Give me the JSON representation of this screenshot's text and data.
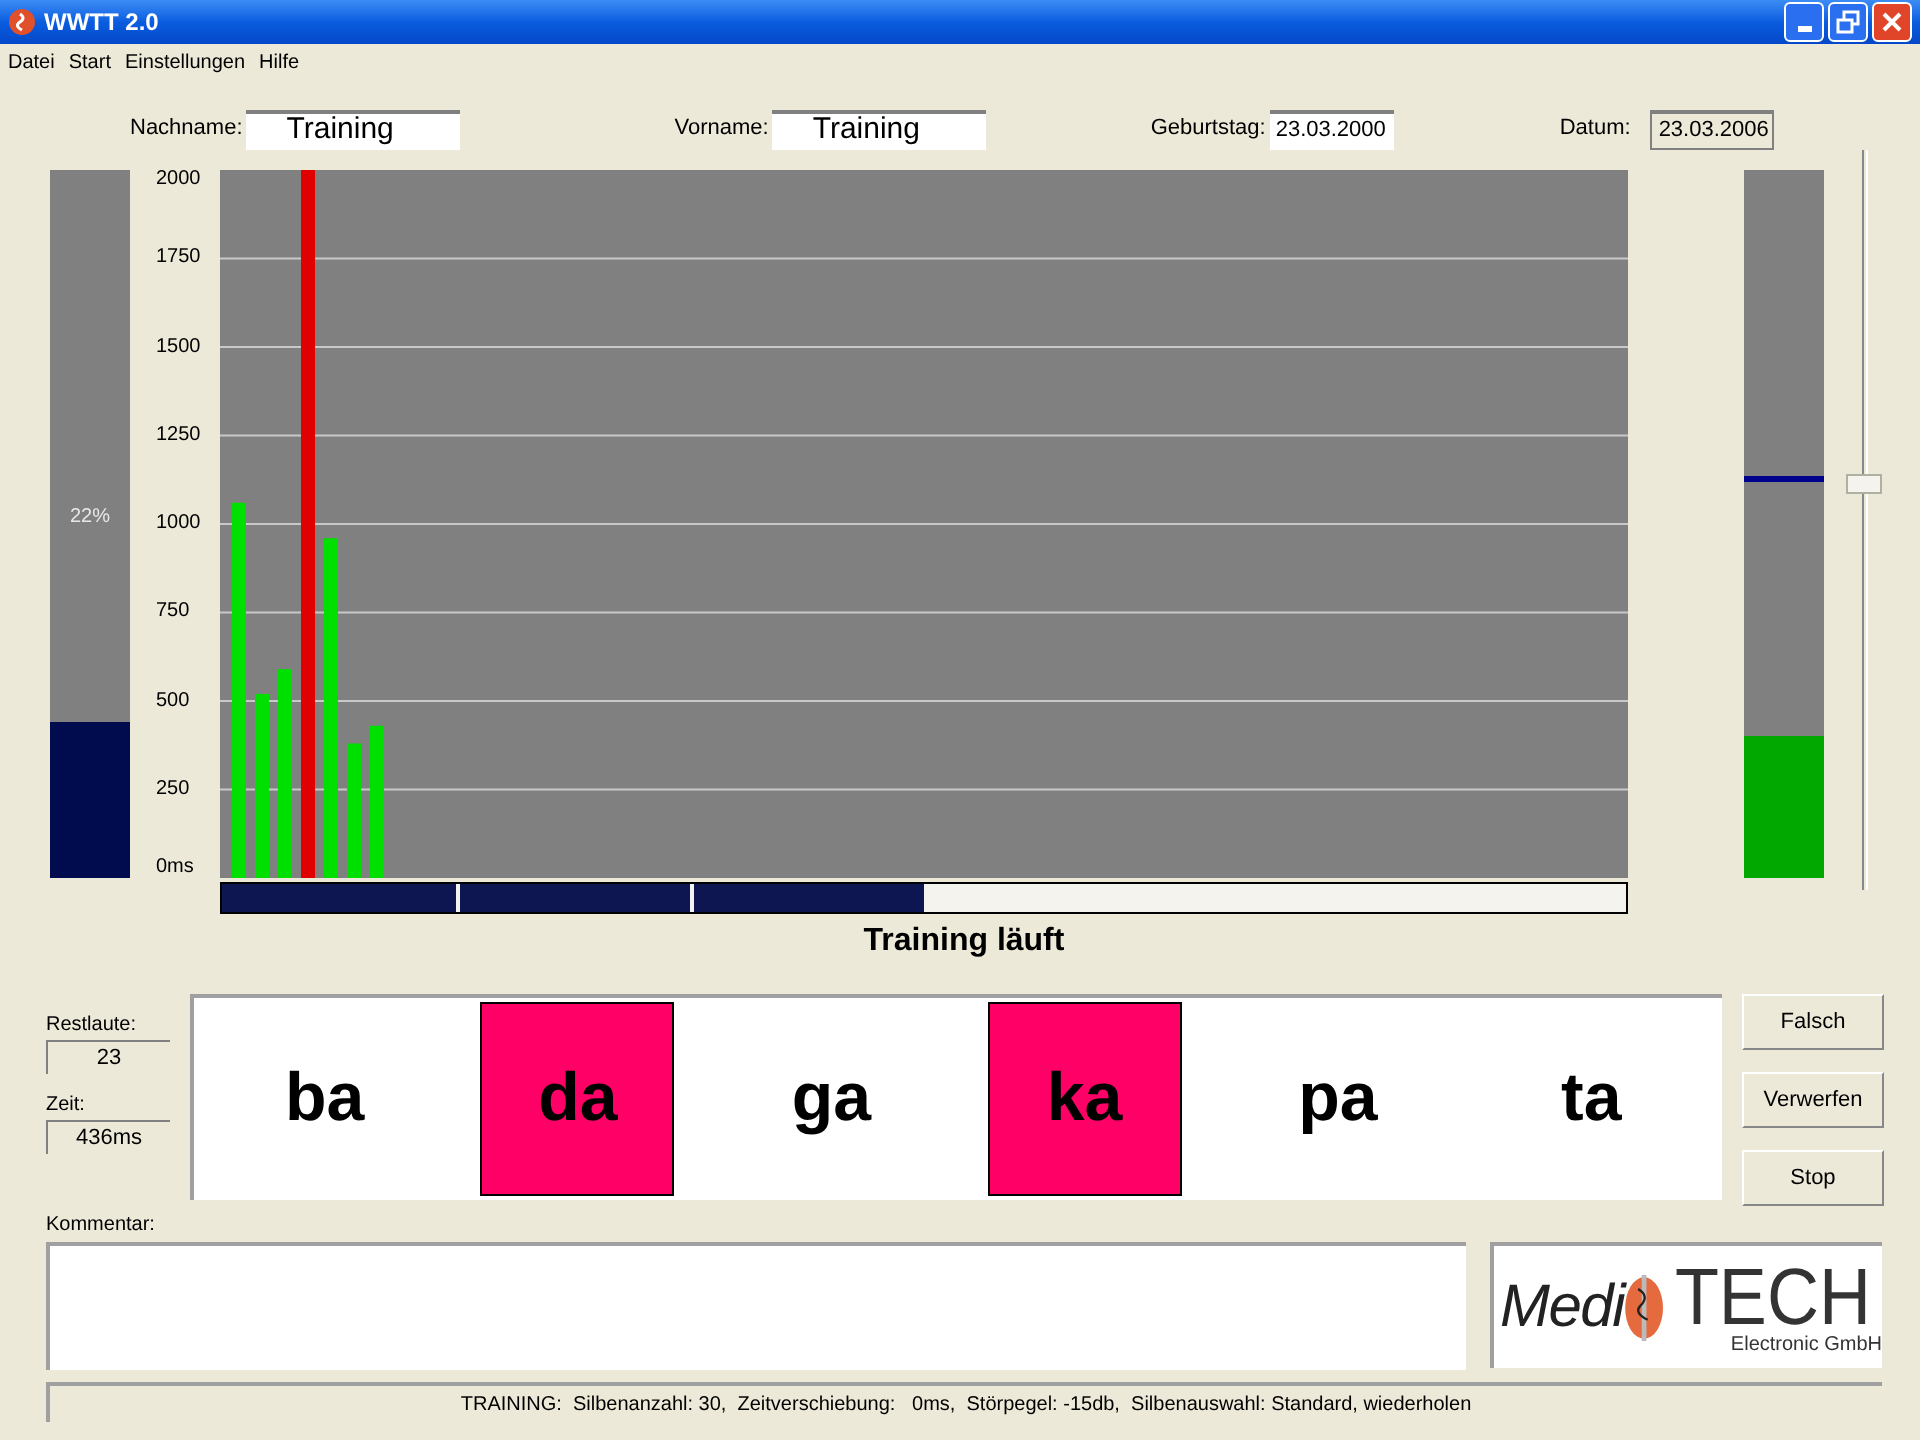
{
  "window": {
    "title": "WWTT 2.0"
  },
  "menu": [
    "Datei",
    "Start",
    "Einstellungen",
    "Hilfe"
  ],
  "fields": [
    {
      "label": "Nachname:",
      "value": "Training",
      "disabled": false,
      "large": true
    },
    {
      "label": "Vorname:",
      "value": "Training",
      "disabled": false,
      "large": true
    },
    {
      "label": "Geburtstag:",
      "value": "23.03.2000",
      "disabled": false,
      "large": false
    },
    {
      "label": "Datum:",
      "value": "23.03.2006",
      "disabled": true,
      "large": false
    }
  ],
  "left_meter": {
    "level": 0.22,
    "reading": "22%"
  },
  "chart_data": {
    "type": "bar",
    "stacked": true,
    "grid": true,
    "categories": [
      null,
      null,
      null,
      null,
      null,
      null,
      null
    ],
    "ylim": [
      0,
      2000
    ],
    "yticks": [
      {
        "value": 0,
        "label": "0ms"
      },
      250,
      500,
      750,
      1000,
      1250,
      1500,
      1750,
      2000
    ],
    "series": [
      {
        "color": "#00e000",
        "values": [
          1060,
          520,
          590,
          null,
          960,
          380,
          430
        ]
      },
      {
        "color": "#e00000",
        "values": [
          null,
          null,
          null,
          2000,
          null,
          null,
          null
        ]
      }
    ]
  },
  "progress": {
    "level": 0.5
  },
  "right_meter": {
    "level": 0.2
  },
  "target_marker": {
    "level": 0.56
  },
  "slider": {
    "level": 0.55
  },
  "status_text": "Training läuft",
  "counters": [
    {
      "label": "Restlaute:",
      "value": "23"
    },
    {
      "label": "Zeit:",
      "value": "436ms"
    }
  ],
  "syllables": [
    {
      "text": "ba",
      "selected": false
    },
    {
      "text": "da",
      "selected": true
    },
    {
      "text": "ga",
      "selected": false
    },
    {
      "text": "ka",
      "selected": true
    },
    {
      "text": "pa",
      "selected": false
    },
    {
      "text": "ta",
      "selected": false
    }
  ],
  "buttons": [
    "Falsch",
    "Verwerfen",
    "Stop"
  ],
  "comment": {
    "label": "Kommentar:"
  },
  "logo": {
    "left": "Medi",
    "right": "TECH",
    "sub": "Electronic GmbH"
  },
  "status_bar": "TRAINING:  Silbenanzahl: 30,  Zeitverschiebung:   0ms,  Störpegel: -15db,  Silbenauswahl: Standard, wiederholen"
}
